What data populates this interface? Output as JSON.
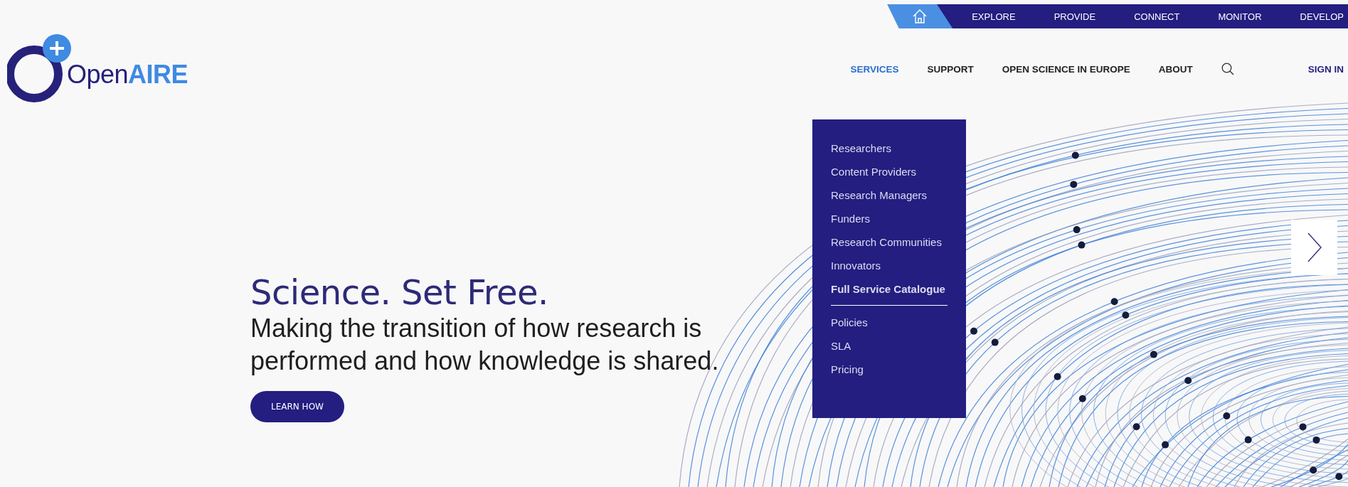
{
  "top_nav": [
    {
      "kind": "home",
      "selected": true
    },
    {
      "kind": "link",
      "label": "EXPLORE",
      "selected": false
    },
    {
      "kind": "link",
      "label": "PROVIDE",
      "selected": false
    },
    {
      "kind": "link",
      "label": "CONNECT",
      "selected": false
    },
    {
      "kind": "link",
      "label": "MONITOR",
      "selected": false
    },
    {
      "kind": "link",
      "label": "DEVELOP",
      "selected": false
    }
  ],
  "logo": {
    "name": "Open",
    "accent": "AIRE"
  },
  "main_nav": [
    {
      "kind": "link",
      "label": "SERVICES",
      "selected": true
    },
    {
      "kind": "link",
      "label": "SUPPORT",
      "selected": false
    },
    {
      "kind": "link",
      "label": "OPEN SCIENCE IN EUROPE",
      "selected": false
    },
    {
      "kind": "link",
      "label": "ABOUT",
      "selected": false
    },
    {
      "kind": "search",
      "selected": false
    },
    {
      "kind": "signin",
      "label": "SIGN IN",
      "selected": false
    }
  ],
  "services_menu": {
    "groups": [
      [
        {
          "label": "Researchers",
          "kind": "link"
        },
        {
          "label": "Content Providers",
          "kind": "link"
        },
        {
          "label": "Research Managers",
          "kind": "link"
        },
        {
          "label": "Funders",
          "kind": "link"
        },
        {
          "label": "Research Communities",
          "kind": "link"
        },
        {
          "label": "Innovators",
          "kind": "link"
        },
        {
          "label": "Full Service Catalogue",
          "kind": "featured"
        }
      ],
      [
        {
          "label": "Policies",
          "kind": "link"
        },
        {
          "label": "SLA",
          "kind": "link"
        },
        {
          "label": "Pricing",
          "kind": "link"
        }
      ]
    ]
  },
  "hero": {
    "title": "Science. Set Free.",
    "subtitle": "Making the transition of how research is performed and how knowledge is shared.",
    "button": "LEARN HOW"
  }
}
